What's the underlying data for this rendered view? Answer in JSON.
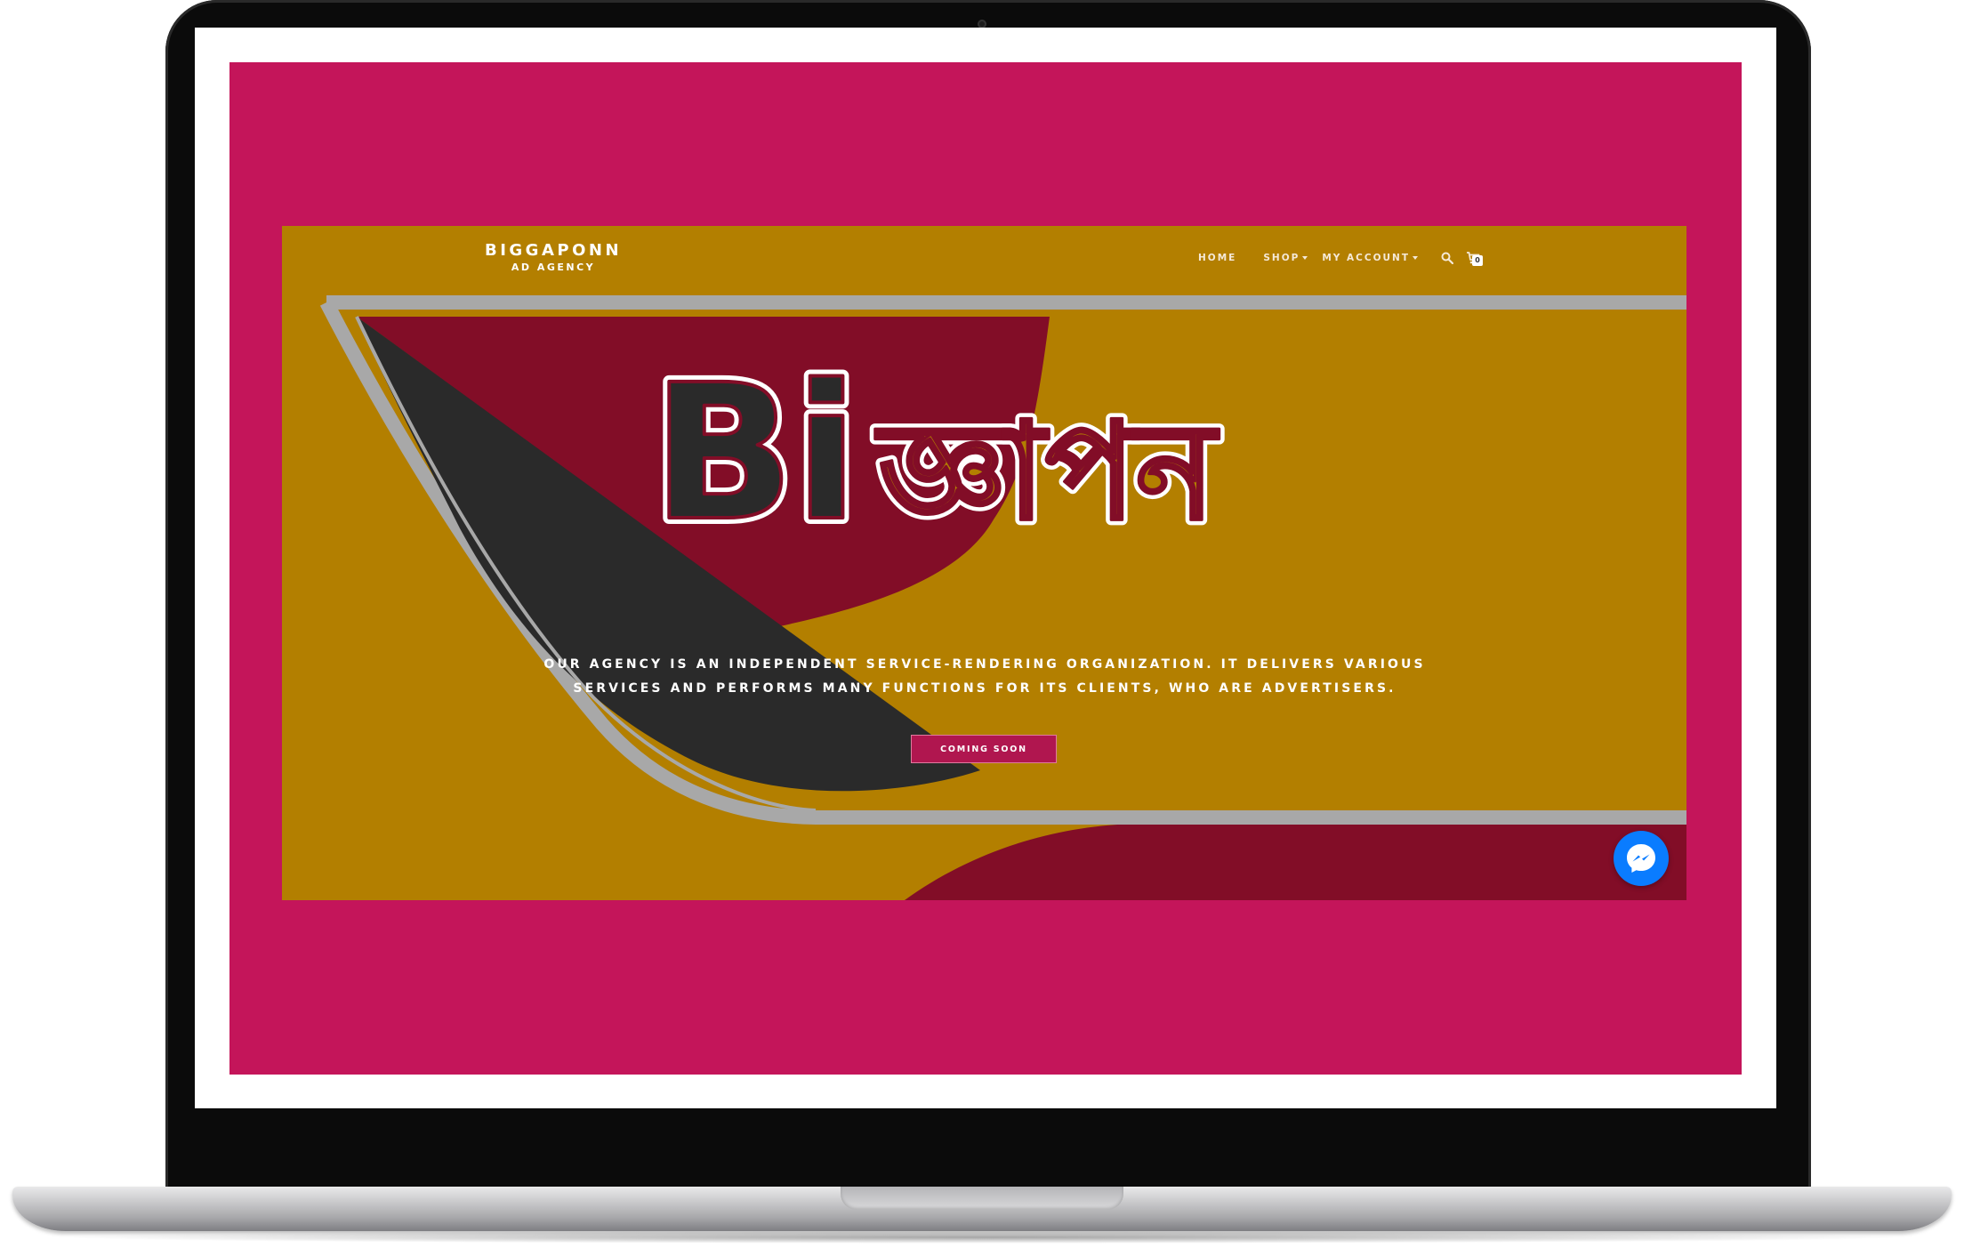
{
  "site": {
    "brand": {
      "name": "BIGGAPONN",
      "tagline": "AD AGENCY"
    },
    "nav": {
      "home": "HOME",
      "shop": "SHOP",
      "account": "MY ACCOUNT",
      "cart_count": "0"
    },
    "hero": {
      "title_latin": "Bi",
      "title_bengali": "জ্ঞাপন",
      "description_line1": "OUR AGENCY IS AN INDEPENDENT SERVICE-RENDERING ORGANIZATION. IT DELIVERS VARIOUS",
      "description_line2": "SERVICES AND PERFORMS MANY FUNCTIONS FOR ITS CLIENTS, WHO ARE ADVERTISERS.",
      "cta_label": "COMING SOON"
    }
  },
  "colors": {
    "page_background": "#c4155a",
    "hero_mustard": "#b37f00",
    "hero_maroon": "#820d27",
    "hero_dark": "#2a2a2a",
    "hero_gray_stroke": "#a8a8a8",
    "button": "#b0164f",
    "messenger": "#0a7cff"
  },
  "icons": {
    "search": "search-icon",
    "cart": "cart-icon",
    "messenger": "messenger-icon"
  }
}
